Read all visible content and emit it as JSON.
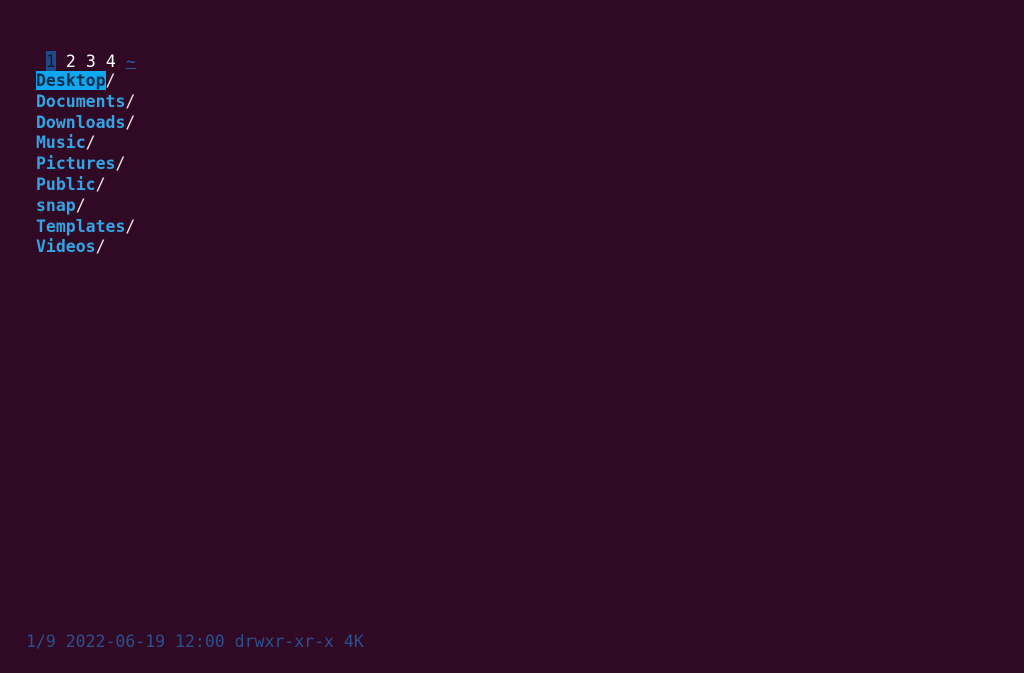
{
  "tabs": [
    {
      "label": "1",
      "active": true
    },
    {
      "label": "2",
      "active": false
    },
    {
      "label": "3",
      "active": false
    },
    {
      "label": "4",
      "active": false
    }
  ],
  "home_label": "~",
  "entries": [
    {
      "name": "Desktop",
      "suffix": "/",
      "selected": true
    },
    {
      "name": "Documents",
      "suffix": "/"
    },
    {
      "name": "Downloads",
      "suffix": "/"
    },
    {
      "name": "Music",
      "suffix": "/"
    },
    {
      "name": "Pictures",
      "suffix": "/"
    },
    {
      "name": "Public",
      "suffix": "/"
    },
    {
      "name": "snap",
      "suffix": "/"
    },
    {
      "name": "Templates",
      "suffix": "/"
    },
    {
      "name": "Videos",
      "suffix": "/"
    }
  ],
  "status": {
    "position": "1/9",
    "date": "2022-06-19",
    "time": "12:00",
    "permissions": "drwxr-xr-x",
    "size": "4K"
  },
  "colors": {
    "background": "#300a24",
    "directory": "#34a3e4",
    "selection": "#0fa8f0",
    "status": "#2b4f8f"
  }
}
